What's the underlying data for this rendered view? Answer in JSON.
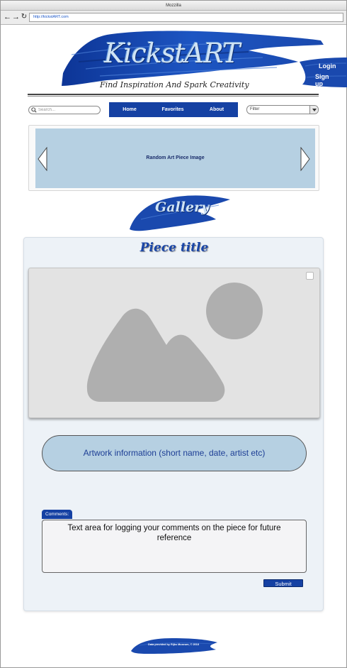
{
  "browser": {
    "title": "Mozzilla",
    "url": "http://kickstART.com"
  },
  "header": {
    "logo": "KickstART",
    "tagline": "Find Inspiration And Spark Creativity",
    "login_label": "Login",
    "signup_label": "Sign up"
  },
  "nav": {
    "search_placeholder": "Search...",
    "items": [
      {
        "label": "Home"
      },
      {
        "label": "Favorites"
      },
      {
        "label": "About"
      }
    ],
    "filter_label": "Filter"
  },
  "carousel": {
    "caption": "Random Art Piece Image"
  },
  "gallery": {
    "title": "Gallery"
  },
  "piece": {
    "title": "Piece title",
    "info": "Artwork information (short name, date, artist etc)",
    "comments_label": "Comments:",
    "comments_text": "Text area for logging your comments on the piece for future reference",
    "submit_label": "Submit"
  },
  "footer": {
    "credit": "Data provided by Rijks Museum, © 2018"
  },
  "colors": {
    "brand_blue": "#1541a3",
    "brush_blue": "#1a4bb0",
    "panel_blue": "#b6d0e2",
    "card_bg": "#edf2f7"
  },
  "icons": {
    "back": "arrow-left-icon",
    "forward": "arrow-right-icon",
    "reload": "reload-icon",
    "search": "search-icon",
    "filter_dropdown": "chevron-down-icon",
    "carousel_prev": "chevron-left-icon",
    "carousel_next": "chevron-right-icon",
    "image_placeholder": "image-placeholder-icon"
  }
}
